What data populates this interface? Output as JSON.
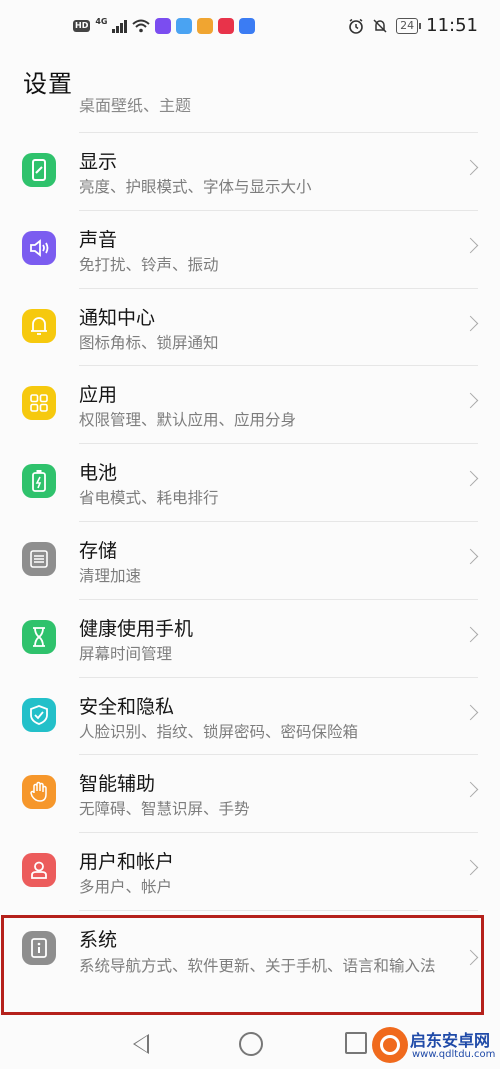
{
  "status_bar": {
    "badge": "HD",
    "network": "4G",
    "battery": "24",
    "time": "11:51"
  },
  "header": {
    "title": "设置"
  },
  "partial_row_text": "桌面壁纸、主题",
  "items": [
    {
      "title": "显示",
      "subtitle": "亮度、护眼模式、字体与显示大小",
      "icon": "display-icon",
      "color": "#2fc26c"
    },
    {
      "title": "声音",
      "subtitle": "免打扰、铃声、振动",
      "icon": "sound-icon",
      "color": "#7b5cf0"
    },
    {
      "title": "通知中心",
      "subtitle": "图标角标、锁屏通知",
      "icon": "bell-icon",
      "color": "#f6c90e"
    },
    {
      "title": "应用",
      "subtitle": "权限管理、默认应用、应用分身",
      "icon": "apps-grid-icon",
      "color": "#f6c90e"
    },
    {
      "title": "电池",
      "subtitle": "省电模式、耗电排行",
      "icon": "battery-icon",
      "color": "#2fc26c"
    },
    {
      "title": "存储",
      "subtitle": "清理加速",
      "icon": "storage-icon",
      "color": "#8e8e8e"
    },
    {
      "title": "健康使用手机",
      "subtitle": "屏幕时间管理",
      "icon": "hourglass-icon",
      "color": "#2fc26c"
    },
    {
      "title": "安全和隐私",
      "subtitle": "人脸识别、指纹、锁屏密码、密码保险箱",
      "icon": "shield-icon",
      "color": "#23c0c9"
    },
    {
      "title": "智能辅助",
      "subtitle": "无障碍、智慧识屏、手势",
      "icon": "hand-icon",
      "color": "#f6972b"
    },
    {
      "title": "用户和帐户",
      "subtitle": "多用户、帐户",
      "icon": "user-icon",
      "color": "#ec5c5c"
    },
    {
      "title": "系统",
      "subtitle": "系统导航方式、软件更新、关于手机、语言和输入法",
      "icon": "system-info-icon",
      "color": "#8e8e8e"
    }
  ],
  "watermark": {
    "line1": "启东安卓网",
    "line2": "www.qdltdu.com"
  }
}
